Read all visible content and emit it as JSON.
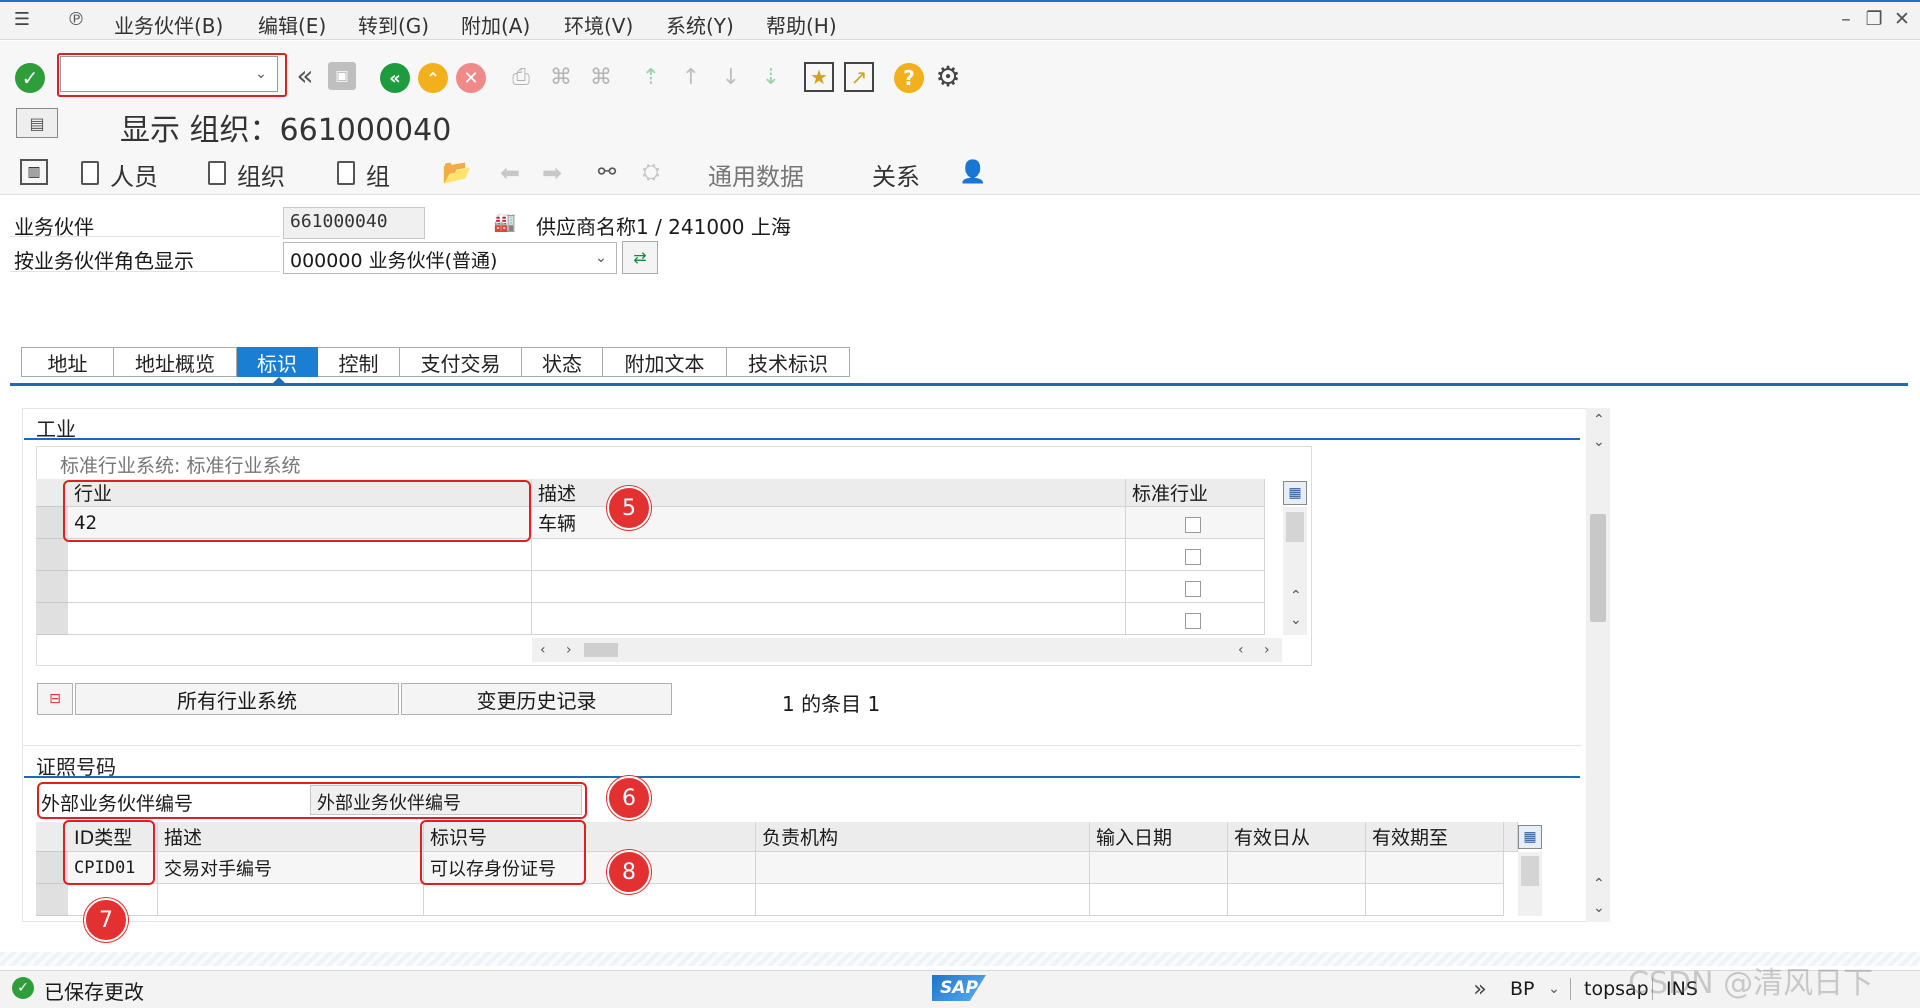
{
  "menu": {
    "items": [
      "业务伙伴(B)",
      "编辑(E)",
      "转到(G)",
      "附加(A)",
      "环境(V)",
      "系统(Y)",
      "帮助(H)"
    ]
  },
  "toolbar": {
    "command_value": "",
    "icons": [
      "enter-icon",
      "back-double-icon",
      "save-icon",
      "back-icon",
      "exit-icon",
      "cancel-icon",
      "print-icon",
      "find-icon",
      "find-next-icon",
      "first-page-icon",
      "prev-page-icon",
      "next-page-icon",
      "last-page-icon",
      "create-session-icon",
      "shortcut-icon",
      "help-icon",
      "settings-icon"
    ]
  },
  "title": {
    "text": "显示 组织：661000040"
  },
  "app_toolbar": {
    "person": "人员",
    "org": "组织",
    "group": "组",
    "general_data": "通用数据",
    "relations": "关系"
  },
  "header": {
    "bp_label": "业务伙伴",
    "bp_value": "661000040",
    "bp_desc": "供应商名称1 / 241000 上海",
    "role_label": "按业务伙伴角色显示",
    "role_value": "000000 业务伙伴(普通)"
  },
  "tabs": [
    {
      "label": "地址",
      "active": false
    },
    {
      "label": "地址概览",
      "active": false
    },
    {
      "label": "标识",
      "active": true
    },
    {
      "label": "控制",
      "active": false
    },
    {
      "label": "支付交易",
      "active": false
    },
    {
      "label": "状态",
      "active": false
    },
    {
      "label": "附加文本",
      "active": false
    },
    {
      "label": "技术标识",
      "active": false
    }
  ],
  "industry": {
    "group_title": "工业",
    "system_label": "标准行业系统: 标准行业系统",
    "columns": [
      "行业",
      "描述",
      "标准行业"
    ],
    "rows": [
      {
        "industry": "42",
        "desc": "车辆"
      }
    ],
    "btn_all": "所有行业系统",
    "btn_history": "变更历史记录",
    "count": "1 的条目 1"
  },
  "license": {
    "group_title": "证照号码",
    "ext_label": "外部业务伙伴编号",
    "ext_value": "外部业务伙伴编号",
    "columns": [
      "ID类型",
      "描述",
      "标识号",
      "负责机构",
      "输入日期",
      "有效日从",
      "有效期至"
    ],
    "rows": [
      {
        "id_type": "CPID01",
        "desc": "交易对手编号",
        "id_no": "可以存身份证号"
      }
    ]
  },
  "callouts": [
    "5",
    "6",
    "7",
    "8"
  ],
  "status": {
    "message": "已保存更改",
    "tx": "BP",
    "server": "topsap",
    "mode": "INS",
    "brand": "SAP"
  },
  "watermark": "CSDN @清风日下"
}
